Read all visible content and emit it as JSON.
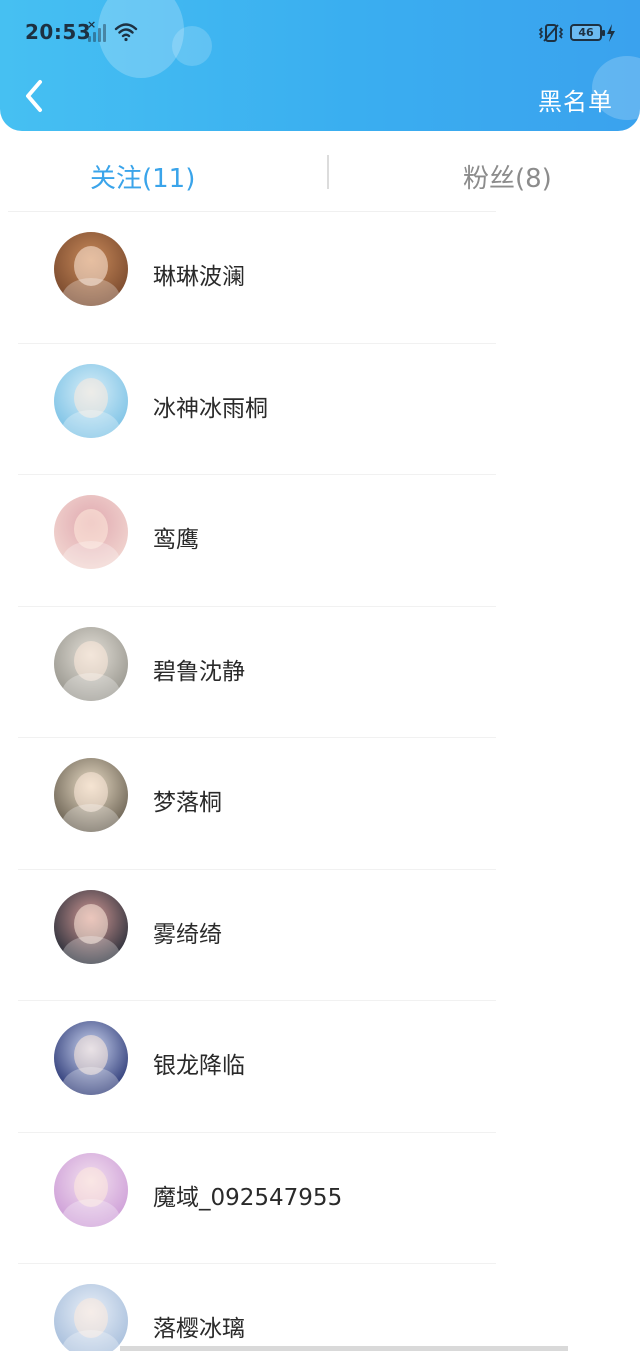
{
  "status_bar": {
    "time": "20:53",
    "network": "46"
  },
  "header": {
    "right_action": "黑名单",
    "back_icon": "chevron-left-icon"
  },
  "tabs": [
    {
      "label": "关注(11)",
      "active": true
    },
    {
      "label": "粉丝(8)",
      "active": false
    }
  ],
  "colors": {
    "header_start": "#46c0f2",
    "header_end": "#3aa2ee",
    "active_tab": "#3aa4ea",
    "inactive_tab": "#8c8c8c"
  },
  "users": [
    {
      "name": "琳琳波澜",
      "avatar_colors": [
        "#7a4a2e",
        "#c98a5a"
      ]
    },
    {
      "name": "冰神冰雨桐",
      "avatar_colors": [
        "#7ec3e6",
        "#d8eef8"
      ]
    },
    {
      "name": "鸾鹰",
      "avatar_colors": [
        "#f1d4cf",
        "#e0a9b0"
      ]
    },
    {
      "name": "碧鲁沈静",
      "avatar_colors": [
        "#9a9890",
        "#e4e0d8"
      ]
    },
    {
      "name": "梦落桐",
      "avatar_colors": [
        "#6d6455",
        "#e9dcc6"
      ]
    },
    {
      "name": "雾绮绮",
      "avatar_colors": [
        "#2b2f3a",
        "#d39a96"
      ]
    },
    {
      "name": "银龙降临",
      "avatar_colors": [
        "#2e3b78",
        "#cfd8f2"
      ]
    },
    {
      "name": "魔域_092547955",
      "avatar_colors": [
        "#ce9fd8",
        "#f3e1ef"
      ]
    },
    {
      "name": "落樱冰璃",
      "avatar_colors": [
        "#a8bfdc",
        "#eaf0f8"
      ]
    }
  ]
}
